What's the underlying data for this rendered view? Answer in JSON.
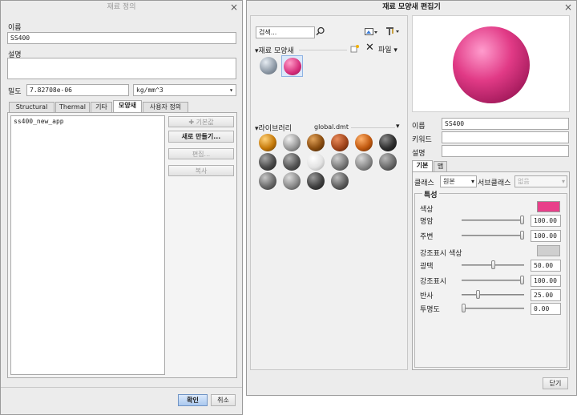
{
  "material_def": {
    "title": "재료 정의",
    "name_label": "이름",
    "name_value": "SS400",
    "desc_label": "설명",
    "desc_value": "",
    "density_label": "밀도",
    "density_value": "7.82708e-06",
    "density_unit": "kg/mm^3",
    "tabs": [
      "Structural",
      "Thermal",
      "기타",
      "모양새",
      "사용자 정의"
    ],
    "active_tab": "모양새",
    "appearance_list": [
      "ss400_new_app"
    ],
    "buttons": {
      "default": "기본값",
      "new": "새로 만들기...",
      "edit": "편집...",
      "copy": "복사"
    },
    "ok": "확인",
    "cancel": "취소"
  },
  "editor": {
    "title": "재료 모양새 편집기",
    "search_placeholder": "검색...",
    "material_section": "재료 모양새",
    "file_menu": "파일",
    "library_label": "라이브러리",
    "library_file": "global.dmt",
    "name_label": "이름",
    "name_value": "SS400",
    "keyword_label": "키워드",
    "keyword_value": "",
    "desc_label": "설명",
    "desc_value": "",
    "tabs": [
      "기본",
      "맵"
    ],
    "active_tab": "기본",
    "class_label": "클래스",
    "class_value": "원본",
    "subclass_label": "서브클래스",
    "subclass_value": "없음",
    "props_title": "특성",
    "color_label": "색상",
    "color_value": "#e8408a",
    "highlight_color_label": "강조표시 색상",
    "highlight_color_value": "#cfcfcf",
    "sliders": [
      {
        "label": "명암",
        "value": "100.00",
        "pct": 1.0
      },
      {
        "label": "주변",
        "value": "100.00",
        "pct": 1.0
      },
      {
        "label": "광택",
        "value": "50.00",
        "pct": 0.5
      },
      {
        "label": "강조표시",
        "value": "100.00",
        "pct": 1.0
      },
      {
        "label": "반사",
        "value": "25.00",
        "pct": 0.25
      },
      {
        "label": "투명도",
        "value": "0.00",
        "pct": 0.0
      }
    ],
    "close": "닫기",
    "sphere_color": "#e13a86"
  }
}
